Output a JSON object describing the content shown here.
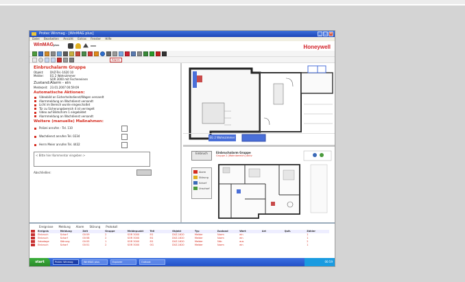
{
  "window": {
    "title": "Protec Winmag - [WinMAG plus]"
  },
  "menu": [
    "Datei",
    "Bearbeiten",
    "Ansicht",
    "Extras",
    "Fenster",
    "Hilfe"
  ],
  "brand": {
    "logo": "WinMAG",
    "logo_suffix": "plus",
    "vendor": "Honeywell"
  },
  "toolbar": {
    "status_label": "Alarm"
  },
  "alarm": {
    "title": "Einbruchalarm Gruppe",
    "fields": [
      {
        "label": "Objekt:",
        "value": "DVZ-Tel.-1620 10"
      },
      {
        "label": "Melder:",
        "value": "EG 2 Wohnzimmer"
      },
      {
        "label": "",
        "value": "SOR 3000 mit Fischeneinen"
      }
    ],
    "state": {
      "label": "Zustand:",
      "value": "Alarm - ein"
    },
    "time": {
      "label": "Meldezeit:",
      "value": "23.01.2007 00:59:09"
    }
  },
  "auto_actions": {
    "title": "Automatische Aktionen:",
    "items": [
      "Videobild an Sicherheitsdienst/Wagen versandt",
      "Alarmmeldung an Wachdienst versandt",
      "Licht im Bereich wurde eingeschaltet",
      "Tür zu Sicherungsbereich 4 ist verriegelt",
      "Video auf Bildschirm 1 eingebildet",
      "Alarmmeldung an Wachdienst versandt"
    ]
  },
  "manual_actions": {
    "title": "Weitere (manuelle) Maßnahmen:",
    "items": [
      "Polizei anrufen - Tel. 110",
      "Wachdienst anrufen Tel. 0234",
      "Herrn Meier anrufen Tel. 4432"
    ]
  },
  "comment": {
    "placeholder": "< Bitte hier Kommentar eingeben >"
  },
  "close_label": "Abschließen:",
  "plan_top": {
    "room_label": "EG 2 Wohnzimmer"
  },
  "plan_bottom": {
    "button": "Einbruch",
    "title": "Einbruchalarm Gruppe",
    "subtitle": "Gruppe 2 (Wohnbereich) aktiv",
    "legend": [
      "Alarm",
      "Störung",
      "Scharf",
      "Unscharf"
    ]
  },
  "log": {
    "tabs": [
      "Ereignisse",
      "Meldung",
      "Alarm",
      "Störung",
      "Protokoll"
    ],
    "headers": [
      "Ereignis",
      "Meldung",
      "Zeit",
      "Gruppe",
      "Meldepunkt",
      "Teil",
      "Objekt",
      "Typ",
      "Zustand",
      "Wert",
      "Art",
      "Quit.",
      "Zähler"
    ],
    "rows": [
      [
        "Einbruch",
        "Scharf",
        "00:59",
        "2",
        "SOR 3000",
        "EG",
        "DVZ-1620",
        "Melder",
        "Alarm",
        "ein",
        "",
        "",
        "1"
      ],
      [
        "Einbruch",
        "Scharf",
        "00:58",
        "2",
        "SOR 3000",
        "EG",
        "DVZ-1620",
        "Melder",
        "Alarm",
        "ein",
        "",
        "",
        "1"
      ],
      [
        "Sabotage",
        "Störung",
        "00:55",
        "1",
        "SOR 3000",
        "EG",
        "DVZ-1620",
        "Melder",
        "Stör.",
        "aus",
        "",
        "",
        "2"
      ],
      [
        "Einbruch",
        "Scharf",
        "00:51",
        "2",
        "SOR 3000",
        "OG",
        "DVZ-1620",
        "Melder",
        "Alarm",
        "ein",
        "",
        "",
        "1"
      ]
    ]
  },
  "taskbar": {
    "start": "start",
    "tasks": [
      "Protec Winmag",
      "WinMAG plus",
      "Explorer",
      "Outlook"
    ],
    "clock": "00:59"
  }
}
